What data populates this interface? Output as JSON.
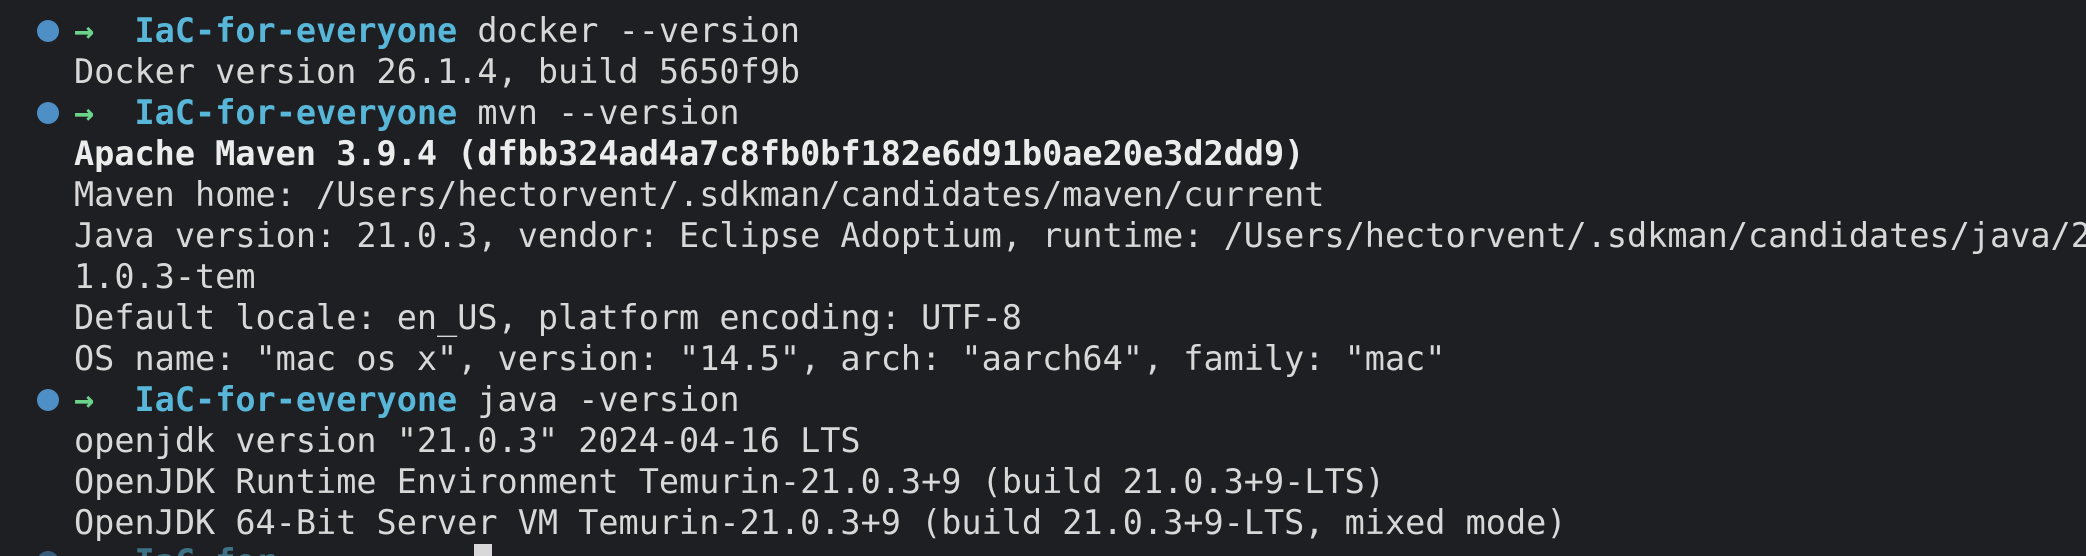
{
  "colors": {
    "background": "#1e1f22",
    "prompt_dot": "#4e8fc6",
    "arrow": "#6cd38b",
    "directory": "#58b7d9",
    "text": "#d8d8d8"
  },
  "prompt": {
    "arrow": "→",
    "directory": "IaC-for-everyone"
  },
  "blocks": [
    {
      "command": "docker --version",
      "output": [
        {
          "text": "Docker version 26.1.4, build 5650f9b",
          "bold": false
        }
      ]
    },
    {
      "command": "mvn --version",
      "output": [
        {
          "text": "Apache Maven 3.9.4 (dfbb324ad4a7c8fb0bf182e6d91b0ae20e3d2dd9)",
          "bold": true
        },
        {
          "text": "Maven home: /Users/hectorvent/.sdkman/candidates/maven/current",
          "bold": false
        },
        {
          "text": "Java version: 21.0.3, vendor: Eclipse Adoptium, runtime: /Users/hectorvent/.sdkman/candidates/java/2",
          "bold": false
        },
        {
          "text": "1.0.3-tem",
          "bold": false
        },
        {
          "text": "Default locale: en_US, platform encoding: UTF-8",
          "bold": false
        },
        {
          "text": "OS name: \"mac os x\", version: \"14.5\", arch: \"aarch64\", family: \"mac\"",
          "bold": false
        }
      ]
    },
    {
      "command": "java -version",
      "output": [
        {
          "text": "openjdk version \"21.0.3\" 2024-04-16 LTS",
          "bold": false
        },
        {
          "text": "OpenJDK Runtime Environment Temurin-21.0.3+9 (build 21.0.3+9-LTS)",
          "bold": false
        },
        {
          "text": "OpenJDK 64-Bit Server VM Temurin-21.0.3+9 (build 21.0.3+9-LTS, mixed mode)",
          "bold": false
        }
      ]
    }
  ],
  "partial_prompt_text": "IaC-for"
}
